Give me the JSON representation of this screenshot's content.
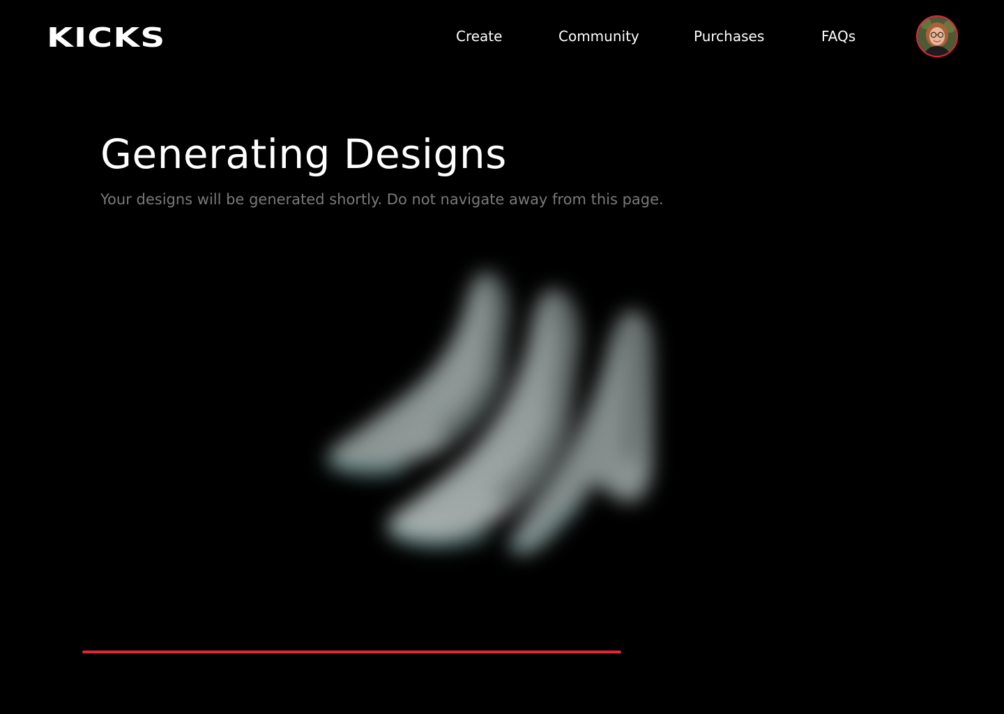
{
  "header": {
    "logo_text": "KICKS",
    "nav": [
      {
        "label": "Create"
      },
      {
        "label": "Community"
      },
      {
        "label": "Purchases"
      },
      {
        "label": "FAQs"
      }
    ],
    "avatar_icon": "user-avatar"
  },
  "main": {
    "title": "Generating Designs",
    "subtitle": "Your designs will be generated shortly. Do not navigate away from this page.",
    "preview_icon": "blurred-sneaker-preview"
  },
  "progress": {
    "fraction": 0.642
  },
  "colors": {
    "background": "#000000",
    "accent": "#e8223e",
    "text": "#ffffff",
    "muted_text": "#7a7a7a"
  }
}
